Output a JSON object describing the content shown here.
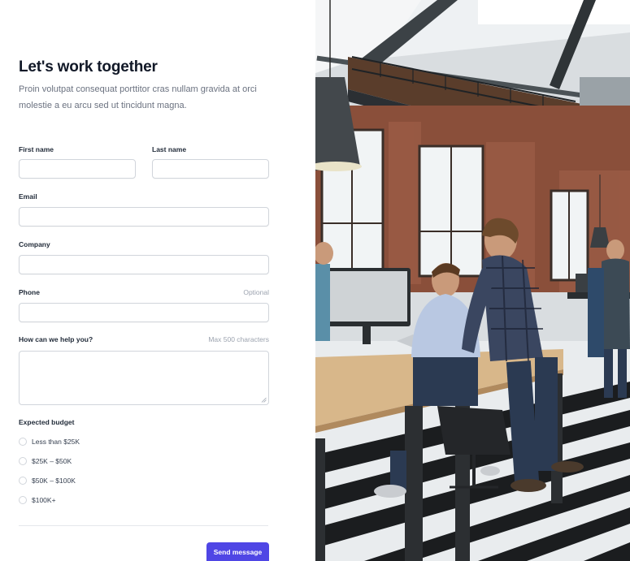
{
  "form": {
    "title": "Let's work together",
    "subtitle": "Proin volutpat consequat porttitor cras nullam gravida at orci molestie a eu arcu sed ut tincidunt magna.",
    "fields": {
      "first_name": {
        "label": "First name",
        "value": "",
        "placeholder": ""
      },
      "last_name": {
        "label": "Last name",
        "value": "",
        "placeholder": ""
      },
      "email": {
        "label": "Email",
        "value": "",
        "placeholder": ""
      },
      "company": {
        "label": "Company",
        "value": "",
        "placeholder": ""
      },
      "phone": {
        "label": "Phone",
        "hint": "Optional",
        "value": "",
        "placeholder": ""
      },
      "message": {
        "label": "How can we help you?",
        "hint": "Max 500 characters",
        "value": "",
        "placeholder": ""
      }
    },
    "budget": {
      "label": "Expected budget",
      "options": [
        "Less than $25K",
        "$25K – $50K",
        "$50K – $100K",
        "$100K+"
      ],
      "selected": null
    },
    "submit_label": "Send message"
  },
  "colors": {
    "accent": "#4f46e5",
    "text_primary": "#111827",
    "text_muted": "#6b7280",
    "border": "#d1d5db"
  },
  "image": {
    "icon": "office-photo",
    "description_shown": false
  }
}
